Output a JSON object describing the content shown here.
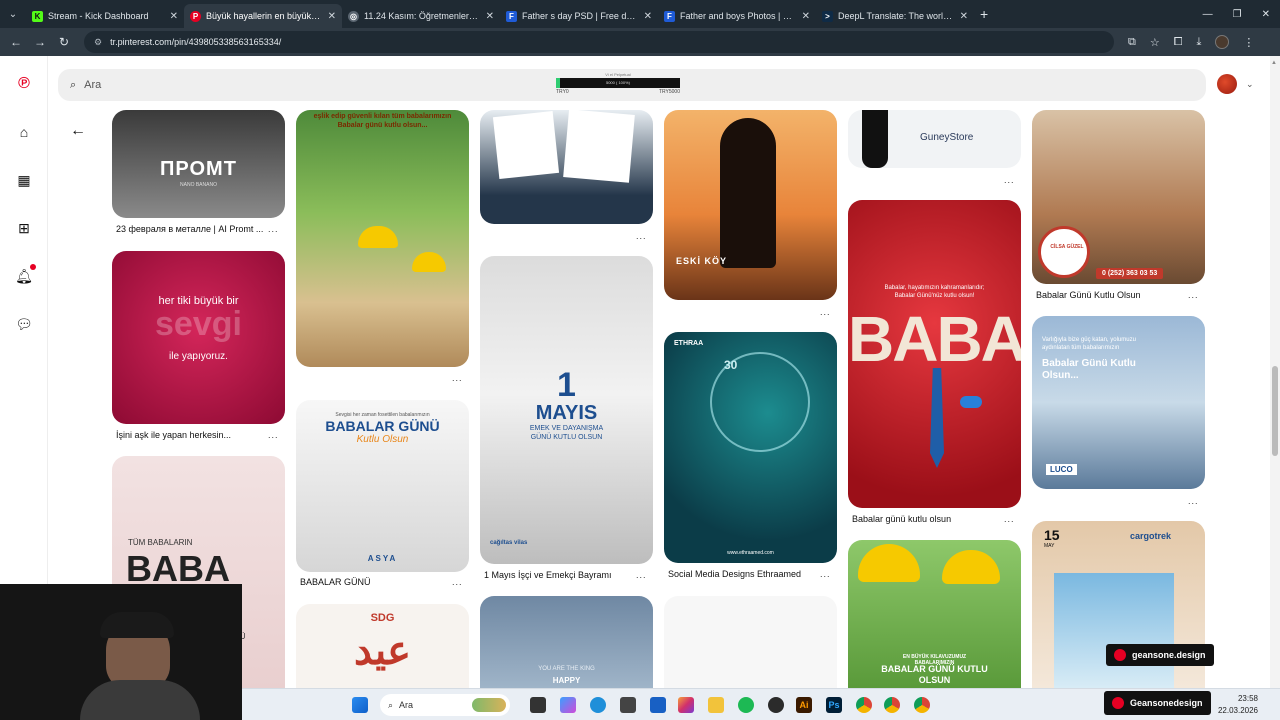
{
  "browser": {
    "tabs": [
      {
        "label": "Stream - Kick Dashboard",
        "fav_color": "#53fc18",
        "fav_glyph": "K",
        "active": false
      },
      {
        "label": "Büyük hayallerin en büyük destekçisi",
        "fav_color": "#e60023",
        "fav_glyph": "P",
        "active": true
      },
      {
        "label": "11.24 Kasım: Öğretmenler Günü",
        "fav_color": "#5a6570",
        "fav_glyph": "◎",
        "active": false
      },
      {
        "label": "Father s day PSD | Free download",
        "fav_color": "#1f5bd6",
        "fav_glyph": "F",
        "active": false
      },
      {
        "label": "Father and boys Photos | Free download",
        "fav_color": "#1f5bd6",
        "fav_glyph": "F",
        "active": false
      },
      {
        "label": "DeepL Translate: The world's most",
        "fav_color": "#0f2b46",
        "fav_glyph": ">",
        "active": false
      }
    ],
    "url": "tr.pinterest.com/pin/439805338563165334/"
  },
  "pinterest": {
    "search_placeholder": "Ara",
    "ticker": {
      "caption": "Vi el Pelpetual",
      "low": "TRY0",
      "high": "TRY5000",
      "mid": "5000 ( 100%)"
    }
  },
  "pins": {
    "c1": [
      {
        "caption": "23 февраля в металле | AI Promt ...",
        "title": "ПРОМТ",
        "sub": "NANO BANANO"
      },
      {
        "caption": "İşini aşk ile yapan herkesin...",
        "title": "her tiki büyük bir",
        "big": "sevgi",
        "sub": "ile yapıyoruz."
      },
      {
        "title": "TÜM BABALARIN",
        "big": "BABA",
        "sub": "NÜ"
      }
    ],
    "c2": [
      {
        "title": "eşlik edip güvenli kılan tüm babalarımızın Babalar günü kutlu olsun..."
      },
      {
        "caption": "BABALAR GÜNÜ",
        "top": "Sevgisi her zaman fosettilen babalarımızın",
        "title": "BABALAR GÜNÜ",
        "script": "Kutlu Olsun",
        "brand": "ASYA"
      },
      {
        "title": "SDG",
        "big": "عيد"
      }
    ],
    "c3": [
      {
        "bottom": "cağıltas vilas"
      },
      {
        "caption": "1 Mayıs İşçi ve Emekçi Bayramı",
        "big": "1",
        "title": "MAYIS",
        "sub": "EMEK VE DAYANIŞMA GÜNÜ KUTLU OLSUN"
      },
      {
        "title": "YOU ARE THE KING",
        "sub": "HAPPY"
      }
    ],
    "c4": [
      {
        "title": "ESKİ KÖY"
      },
      {
        "caption": "Social Media Designs Ethraamed",
        "title": "30",
        "brand": "ETHRAA",
        "footer": "www.ethraamed.com"
      },
      {}
    ],
    "c5": [
      {
        "title": "GuneyStore"
      },
      {
        "caption": "Babalar günü kutlu olsun",
        "top": "Babalar, hayatımızın kahramanlarıdır; Babalar Günü'nüz kutlu olsun!",
        "big": "BABA"
      },
      {
        "title": "EN BÜYÜK KILAVUZUMUZ BABALARIMIZIN",
        "sub": "BABALAR GÜNÜ KUTLU OLSUN"
      }
    ],
    "c6": [
      {
        "caption": "Babalar Günü Kutlu Olsun",
        "badge": "CİLSA GÜZEL",
        "phone": "0 (252) 363 03 53"
      },
      {
        "top": "Varlığıyla bize güç katan, yolumuzu aydınlatan tüm babalarımızın",
        "title": "Babalar Günü Kutlu Olsun...",
        "brand": "LUCO"
      },
      {
        "date": "15",
        "month": "MAY",
        "brand": "cargotrek"
      }
    ]
  },
  "dots": "...",
  "taskbar": {
    "search": "Ara",
    "time": "23:58",
    "date": "22.03.2026"
  },
  "watermarks": {
    "a": "geansone.design",
    "b": "Geansonedesign"
  }
}
